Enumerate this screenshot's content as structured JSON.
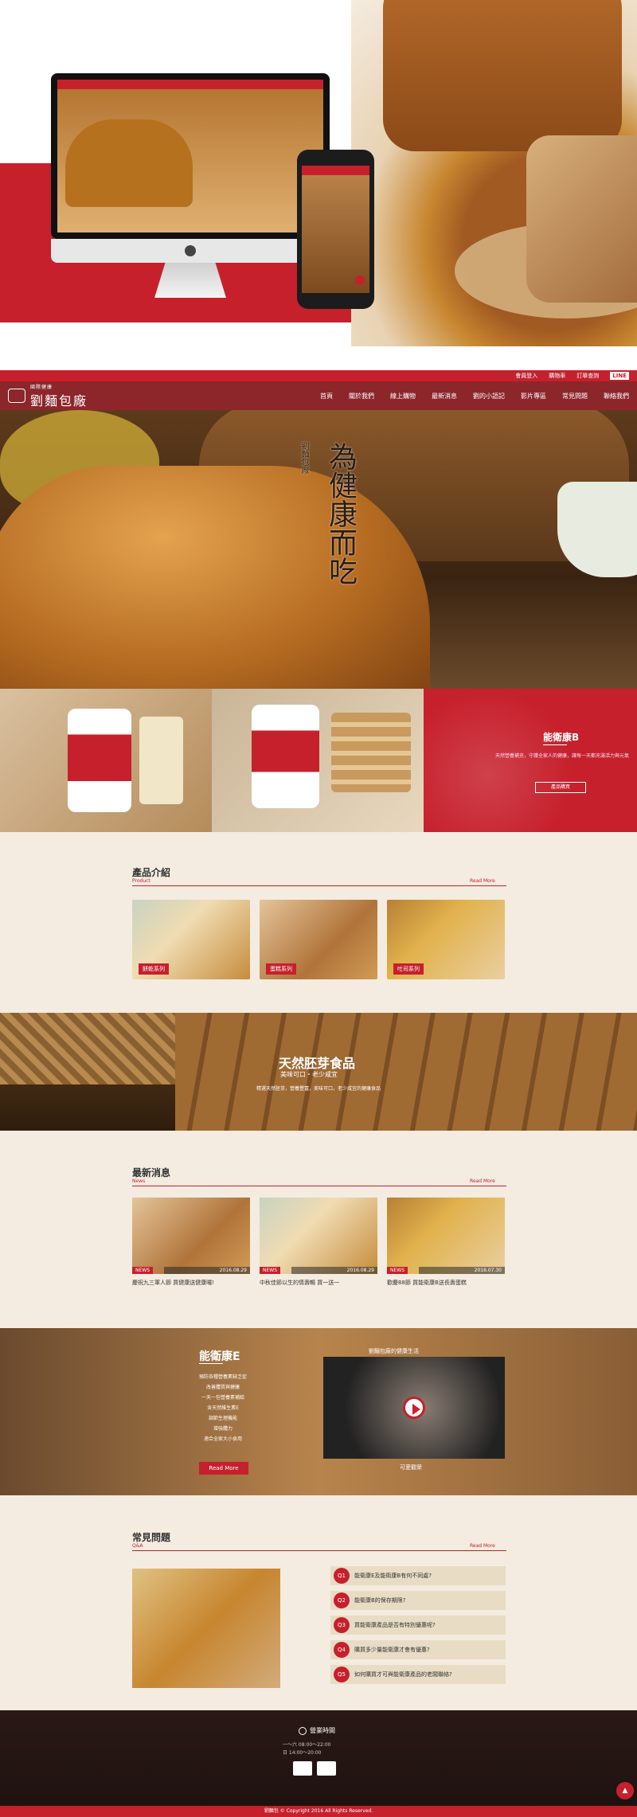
{
  "topbar": {
    "login": "會員登入",
    "cart": "購物車",
    "order": "訂單查詢",
    "lang": "LINE"
  },
  "brand": {
    "sub": "國際健康",
    "name": "劉麵包廠"
  },
  "nav": [
    "首頁",
    "關於我們",
    "線上購物",
    "最新消息",
    "劉的小語記",
    "影片專區",
    "常見問題",
    "聯絡我們"
  ],
  "banner": {
    "calli_main": "為健康而吃",
    "calli_side": "劉麵包廠"
  },
  "tile3": {
    "title": "能衛康B",
    "text": "天然營養補充，守護全家人的健康，讓每一天都充滿活力與元氣",
    "button": "產品購買"
  },
  "products": {
    "title": "產品介紹",
    "sub": "Product",
    "readmore": "Read More",
    "cards": [
      {
        "label": "餅乾系列"
      },
      {
        "label": "蛋糕系列"
      },
      {
        "label": "吐司系列"
      }
    ]
  },
  "germ": {
    "title": "天然胚芽食品",
    "subtitle": "美味可口・老少咸宜",
    "desc": "精選天然胚芽，營養豐富，美味可口，老少咸宜的健康食品"
  },
  "news": {
    "title": "最新消息",
    "sub": "News",
    "readmore": "Read More",
    "items": [
      {
        "badge": "NEWS",
        "date": "2016.08.29",
        "title": "慶祝九三軍人節 買健康送健康囉!"
      },
      {
        "badge": "NEWS",
        "date": "2016.08.29",
        "title": "中秋佳節以生的情壽暢 買一送一"
      },
      {
        "badge": "NEWS",
        "date": "2016.07.30",
        "title": "歡慶88節 買能衛康B送長壽蛋糕"
      }
    ]
  },
  "nutri": {
    "title": "能衛康E",
    "items": [
      "預防各種營養素缺乏症",
      "改善體質與健康",
      "一天一包營養素補給",
      "含天然維生素E",
      "調節生理機能",
      "增強體力",
      "適合全家大小食用"
    ],
    "button": "Read More",
    "video_title": "劉麵包廠的健康生活",
    "video_caption": "可愛觀眾"
  },
  "faq": {
    "title": "常見問題",
    "sub": "Q&A",
    "readmore": "Read More",
    "items": [
      {
        "q": "Q1",
        "text": "能衛康E及能衛康B有何不同處?"
      },
      {
        "q": "Q2",
        "text": "能衛康B的保存期限?"
      },
      {
        "q": "Q3",
        "text": "買能衛康產品是否有特別優惠呢?"
      },
      {
        "q": "Q4",
        "text": "購買多少量能衛康才會有優惠?"
      },
      {
        "q": "Q5",
        "text": "如何購買才可與能衛康產品的老闆聯絡?"
      }
    ]
  },
  "footer": {
    "heading": "營業時間",
    "line1": "一～六 08:00～22:00",
    "line2": "日 14:00～20:00",
    "totop": "▲"
  },
  "copyright": "劉麵包 © Copyright 2016 All Rights Reserved.",
  "colors": {
    "brand": "#c6202c",
    "cream": "#f4ece0",
    "dark": "#2a1916"
  }
}
